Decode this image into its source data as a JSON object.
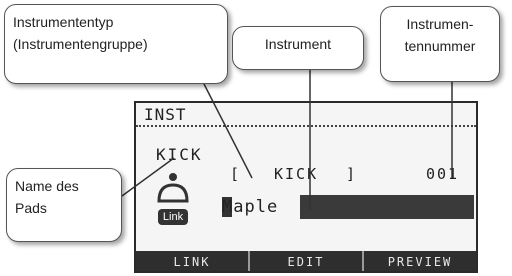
{
  "callouts": {
    "instrument_type_line1": "Instrumententyp",
    "instrument_type_line2": "(Instrumentengruppe)",
    "instrument": "Instrument",
    "instrument_number_line1": "Instrumen-",
    "instrument_number_line2": "tennummer",
    "pad_name_line1": "Name des",
    "pad_name_line2": "Pads"
  },
  "lcd": {
    "title": "INST",
    "pad_name": "KICK",
    "bracket_left": "[",
    "instrument_type": "KICK",
    "bracket_right": "]",
    "instrument_number": "001",
    "instrument_name": "Maple",
    "link_badge": "Link",
    "softkeys": [
      "LINK",
      "EDIT",
      "PREVIEW"
    ]
  },
  "icons": {
    "pad": "kick-drum-icon"
  }
}
